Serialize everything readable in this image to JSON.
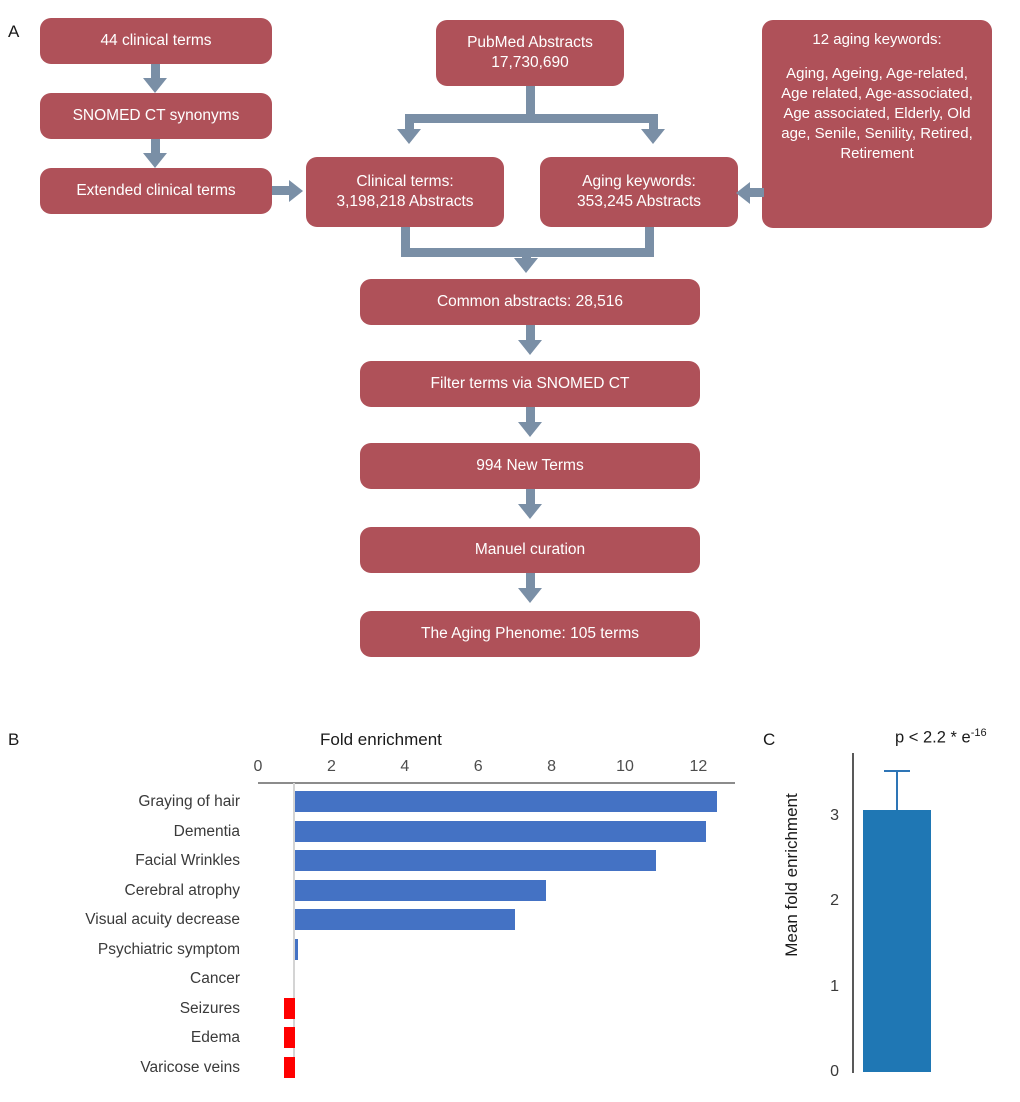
{
  "panels": {
    "a_letter": "A",
    "b_letter": "B",
    "c_letter": "C"
  },
  "colors": {
    "box_fill": "#AF5159",
    "connector": "#7A8FA6",
    "bar_positive": "#4472C4",
    "bar_negative": "#FF0000",
    "bar_panel_c": "#1F77B4",
    "axis": "#8c8c8c"
  },
  "flowchart": {
    "boxes": {
      "clinical_terms": "44  clinical terms",
      "snomed_synonyms": "SNOMED CT synonyms",
      "extended_terms": "Extended clinical terms",
      "pubmed_line1": "PubMed Abstracts",
      "pubmed_line2": "17,730,690",
      "clinical_abstracts_line1": "Clinical terms:",
      "clinical_abstracts_line2": "3,198,218 Abstracts",
      "aging_abstracts_line1": "Aging keywords:",
      "aging_abstracts_line2": "353,245 Abstracts",
      "keywords_title": "12 aging keywords:",
      "keywords_body": "Aging, Ageing, Age-related, Age related, Age-associated, Age associated, Elderly, Old age, Senile, Senility, Retired, Retirement",
      "common_abstracts": "Common abstracts: 28,516",
      "filter_terms": "Filter terms via SNOMED CT",
      "new_terms": "994 New Terms",
      "manual_curation": "Manuel curation",
      "aging_phenome": "The Aging Phenome: 105 terms"
    }
  },
  "chart_data": [
    {
      "type": "bar",
      "orientation": "horizontal",
      "title": "Fold enrichment",
      "xlabel": "Fold enrichment",
      "ylabel": "",
      "xlim": [
        0,
        13
      ],
      "xticks": [
        0,
        2,
        4,
        6,
        8,
        10,
        12
      ],
      "xticklabels": [
        "0",
        "2",
        "4",
        "6",
        "8",
        "10",
        "12"
      ],
      "baseline": 1,
      "grid": false,
      "legend": "none",
      "categories": [
        "Graying of hair",
        "Dementia",
        "Facial Wrinkles",
        "Cerebral atrophy",
        "Visual acuity decrease",
        "Psychiatric symptom",
        "Cancer",
        "Seizures",
        "Edema",
        "Varicose veins"
      ],
      "values": [
        12.5,
        12.2,
        10.85,
        7.86,
        7.0,
        1.1,
        1.0,
        0.7,
        0.7,
        0.7
      ],
      "bar_colors": [
        "#4472C4",
        "#4472C4",
        "#4472C4",
        "#4472C4",
        "#4472C4",
        "#4472C4",
        "#4472C4",
        "#FF0000",
        "#FF0000",
        "#FF0000"
      ]
    },
    {
      "type": "bar",
      "orientation": "vertical",
      "title": "",
      "annotation": "p < 2.2 * e",
      "annotation_exponent": "-16",
      "xlabel": "",
      "ylabel": "Mean fold enrichment",
      "ylim": [
        0,
        3.75
      ],
      "yticks": [
        0,
        1,
        2,
        3
      ],
      "yticklabels": [
        "0",
        "1",
        "2",
        "3"
      ],
      "grid": false,
      "legend": "none",
      "categories": [
        ""
      ],
      "values": [
        3.07
      ],
      "errors": [
        0.46
      ],
      "bar_colors": [
        "#1F77B4"
      ]
    }
  ]
}
